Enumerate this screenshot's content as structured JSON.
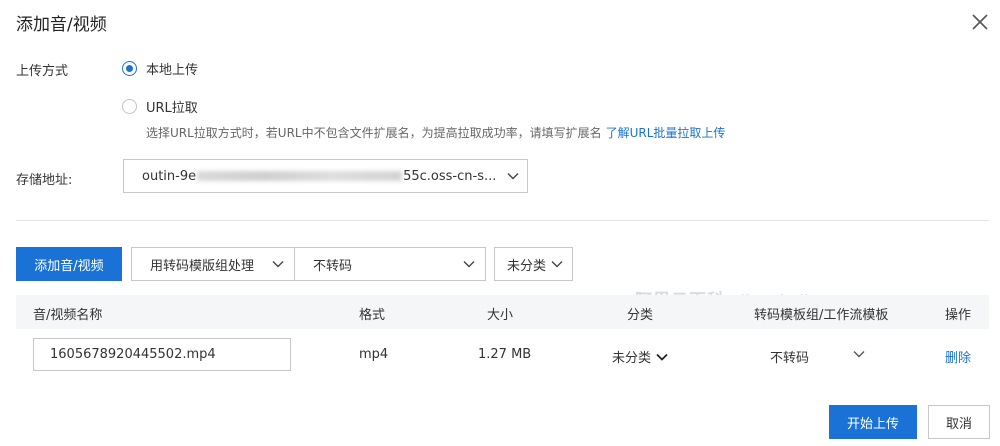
{
  "dialog": {
    "title": "添加音/视频",
    "close_icon": "close-icon"
  },
  "upload": {
    "label": "上传方式",
    "option_local": "本地上传",
    "option_url": "URL拉取",
    "selected": "本地上传",
    "hint": "选择URL拉取方式时，若URL中不包含文件扩展名，为提高拉取成功率，请填写扩展名",
    "hint_link": "了解URL批量拉取上传"
  },
  "storage": {
    "label": "存储地址:",
    "value_prefix": "outin-9e",
    "value_suffix": "55c.oss-cn-s..."
  },
  "toolbar": {
    "add_button": "添加音/视频",
    "process_select": "用转码模版组处理",
    "template_select": "不转码",
    "category_select": "未分类"
  },
  "table": {
    "headers": [
      "音/视频名称",
      "格式",
      "大小",
      "分类",
      "转码模板组/工作流模板",
      "操作"
    ],
    "rows": [
      {
        "name": "1605678920445502.mp4",
        "format": "mp4",
        "size": "1.27 MB",
        "category": "未分类",
        "template": "不转码",
        "action": "删除"
      }
    ]
  },
  "footer": {
    "start_button": "开始上传",
    "cancel_button": "取消"
  },
  "watermark": {
    "brand": "阿里云百科",
    "domain": "aliyunbaike.com"
  },
  "colors": {
    "primary": "#1a72d6",
    "border": "#c8c8c8",
    "header_bg": "#f5f6f7"
  }
}
